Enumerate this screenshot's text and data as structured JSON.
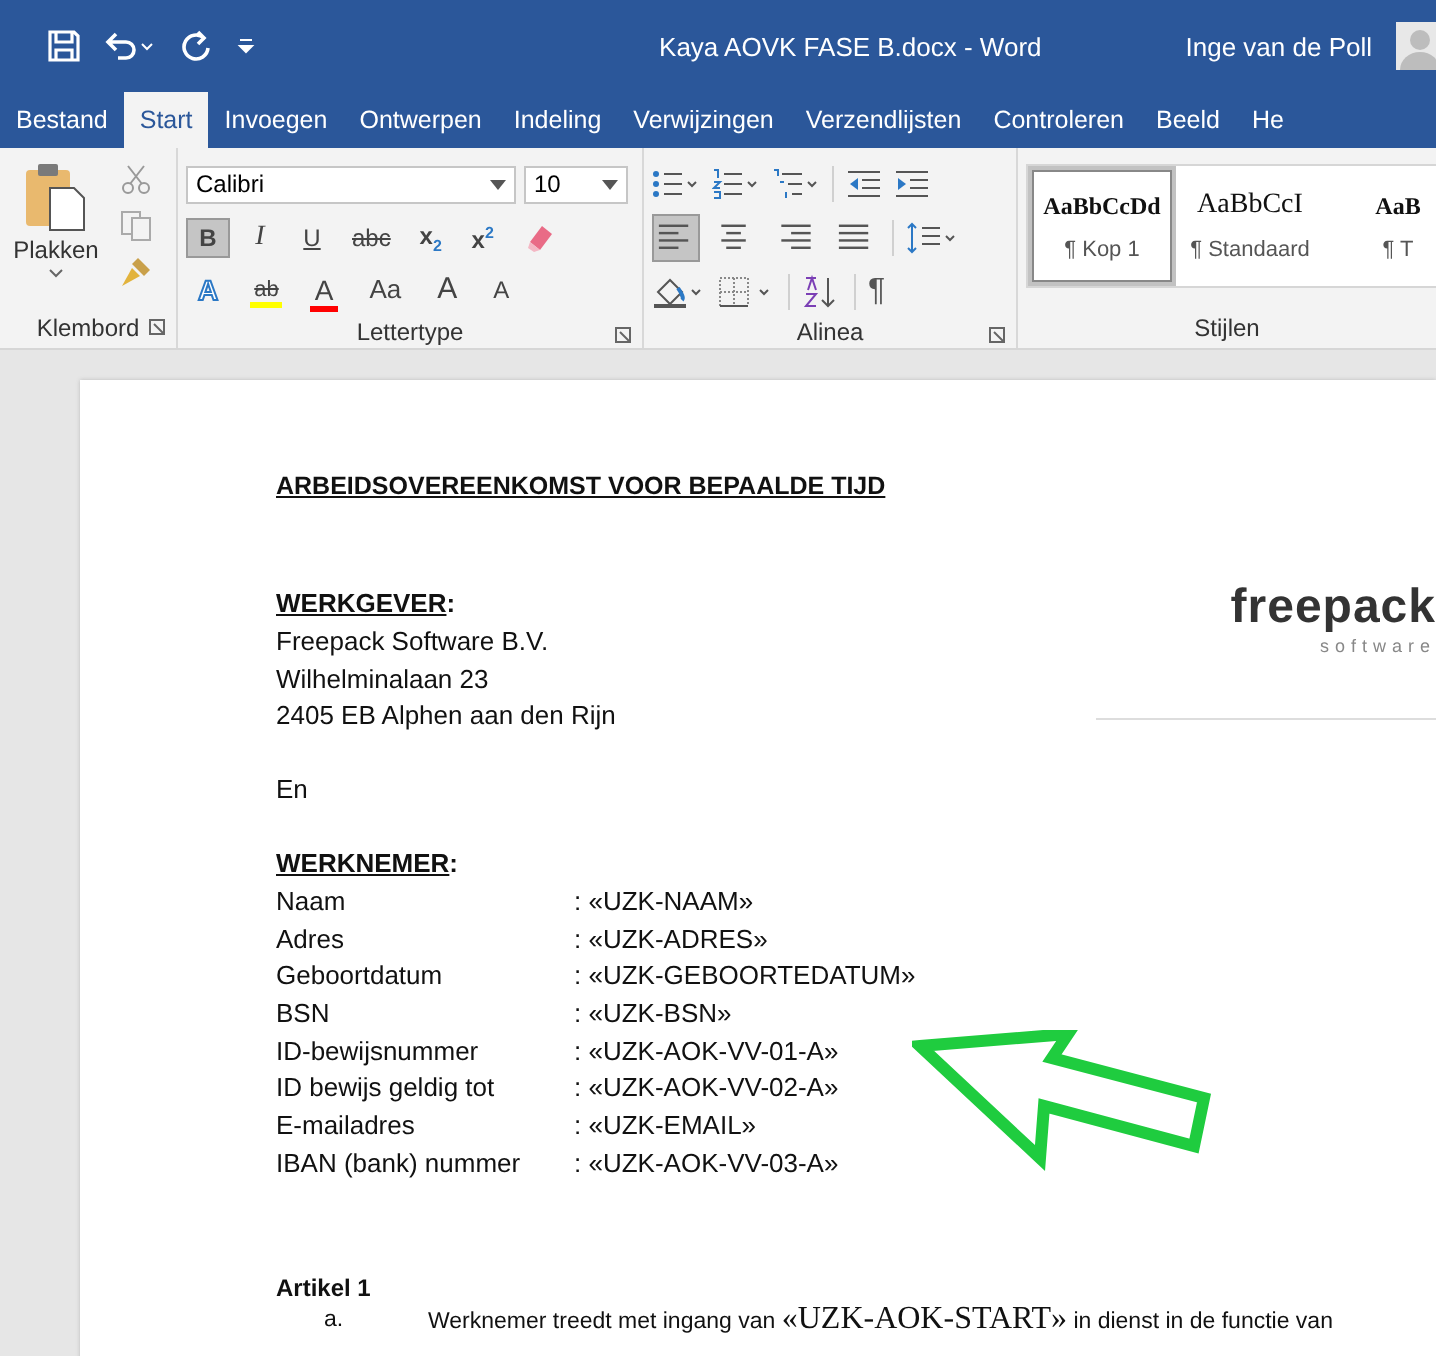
{
  "window": {
    "title": "Kaya AOVK FASE B.docx  -  Word",
    "user": "Inge van de Poll"
  },
  "tabs": [
    {
      "label": "Bestand",
      "selected": false
    },
    {
      "label": "Start",
      "selected": true
    },
    {
      "label": "Invoegen",
      "selected": false
    },
    {
      "label": "Ontwerpen",
      "selected": false
    },
    {
      "label": "Indeling",
      "selected": false
    },
    {
      "label": "Verwijzingen",
      "selected": false
    },
    {
      "label": "Verzendlijsten",
      "selected": false
    },
    {
      "label": "Controleren",
      "selected": false
    },
    {
      "label": "Beeld",
      "selected": false
    },
    {
      "label": "He",
      "selected": false
    }
  ],
  "ribbon": {
    "clipboard": {
      "paste": "Plakken",
      "label": "Klembord"
    },
    "font": {
      "name": "Calibri",
      "size": "10",
      "label": "Lettertype",
      "row1": [
        {
          "kind": "bold",
          "label": "B",
          "selected": true
        },
        {
          "kind": "italic",
          "label": "I",
          "selected": false
        },
        {
          "kind": "underline",
          "label": "U",
          "selected": false
        },
        {
          "kind": "strike",
          "label": "abc",
          "selected": false
        },
        {
          "kind": "sub",
          "label": "x",
          "index": "2",
          "selected": false
        },
        {
          "kind": "sup",
          "label": "x",
          "index": "2",
          "selected": false
        }
      ],
      "row2": [
        {
          "kind": "effects",
          "label": "A"
        },
        {
          "kind": "highlight",
          "label": "ab",
          "color": "#ffff00"
        },
        {
          "kind": "fontcolor",
          "label": "A",
          "color": "#ff0000"
        },
        {
          "kind": "case",
          "label": "Aa"
        },
        {
          "kind": "grow",
          "label": "A"
        },
        {
          "kind": "shrink",
          "label": "A"
        }
      ]
    },
    "paragraph": {
      "label": "Alinea",
      "align": [
        {
          "kind": "left",
          "selected": true
        },
        {
          "kind": "center",
          "selected": false
        },
        {
          "kind": "right",
          "selected": false
        },
        {
          "kind": "justify",
          "selected": false
        }
      ],
      "pilcrow": "¶"
    },
    "styles": {
      "label": "Stijlen",
      "items": [
        {
          "sample": "AaBbCcDd",
          "name": "¶ Kop 1",
          "selected": true,
          "kind": "heading"
        },
        {
          "sample": "AaBbCcI",
          "name": "¶ Standaard",
          "selected": false,
          "kind": "normal"
        },
        {
          "sample": "AaB",
          "name": "¶ T",
          "selected": false,
          "kind": "heading"
        }
      ]
    }
  },
  "document": {
    "title": "ARBEIDSOVEREENKOMST VOOR  BEPAALDE TIJD",
    "logo": {
      "name": "freepack",
      "tagline": "software"
    },
    "employer": {
      "heading": "WERKGEVER",
      "colon": ":",
      "lines": [
        "Freepack Software B.V.",
        "Wilhelminalaan 23",
        "2405 EB Alphen aan den Rijn"
      ]
    },
    "connector": "En",
    "employee": {
      "heading": "WERKNEMER",
      "colon": ":",
      "fields": [
        {
          "label": "Naam",
          "value": ": «UZK-NAAM»"
        },
        {
          "label": "Adres",
          "value": ": «UZK-ADRES»"
        },
        {
          "label": "Geboortdatum",
          "value": ": «UZK-GEBOORTEDATUM»"
        },
        {
          "label": "BSN",
          "value": ": «UZK-BSN»"
        },
        {
          "label": "ID-bewijsnummer",
          "value": ": «UZK-AOK-VV-01-A»"
        },
        {
          "label": "ID bewijs geldig tot",
          "value": ": «UZK-AOK-VV-02-A»"
        },
        {
          "label": "E-mailadres",
          "value": ": «UZK-EMAIL»"
        },
        {
          "label": "IBAN (bank) nummer",
          "value": ": «UZK-AOK-VV-03-A»"
        }
      ]
    },
    "article": {
      "heading": "Artikel 1",
      "items": [
        {
          "marker": "a.",
          "before": "Werknemer treedt met ingang van",
          "field": "«UZK-AOK-START»",
          "after": "in dienst in de functie van"
        }
      ]
    }
  }
}
